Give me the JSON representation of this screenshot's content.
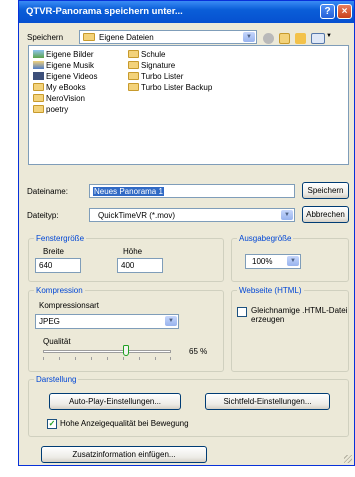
{
  "window": {
    "title": "QTVR-Panorama speichern unter...",
    "help_glyph": "?",
    "close_glyph": "×"
  },
  "toolbar": {
    "save_in_label": "Speichern",
    "save_in_value": "Eigene Dateien",
    "icons": [
      "back-icon",
      "up-folder-icon",
      "new-folder-icon",
      "views-icon"
    ]
  },
  "files": {
    "col1": [
      "Eigene Bilder",
      "Eigene Musik",
      "Eigene Videos",
      "My eBooks",
      "NeroVision",
      "poetry"
    ],
    "col2": [
      "Schule",
      "Signature",
      "Turbo Lister",
      "Turbo Lister Backup"
    ]
  },
  "filename": {
    "label": "Dateiname:",
    "value": "Neues Panorama 1",
    "save_button": "Speichern"
  },
  "filetype": {
    "label": "Dateityp:",
    "value": "QuickTimeVR (*.mov)",
    "cancel_button": "Abbrechen"
  },
  "fenstergroesse": {
    "title": "Fenstergröße",
    "width_label": "Breite",
    "width_value": "640",
    "height_label": "Höhe",
    "height_value": "400"
  },
  "ausgabegroesse": {
    "title": "Ausgabegröße",
    "value": "100%"
  },
  "kompression": {
    "title": "Kompression",
    "type_label": "Kompressionsart",
    "type_value": "JPEG",
    "quality_label": "Qualität",
    "quality_value": "65 %",
    "quality_level": 0.65
  },
  "webseite": {
    "title": "Webseite (HTML)",
    "checkbox_label_1": "Gleichnamige .HTML-Datei",
    "checkbox_label_2": "erzeugen",
    "checked": false
  },
  "darstellung": {
    "title": "Darstellung",
    "autoplay_button": "Auto-Play-Einstellungen...",
    "view_button": "Sichtfeld-Einstellungen...",
    "quality_checkbox": "Hohe Anzeigequalität bei Bewegung",
    "quality_checked": true
  },
  "extra_button": "Zusatzinformation einfügen...",
  "colors": {
    "accent": "#0046d5",
    "selection": "#316ac5",
    "title_bar": "#0a5ed8",
    "close": "#c9411c"
  }
}
